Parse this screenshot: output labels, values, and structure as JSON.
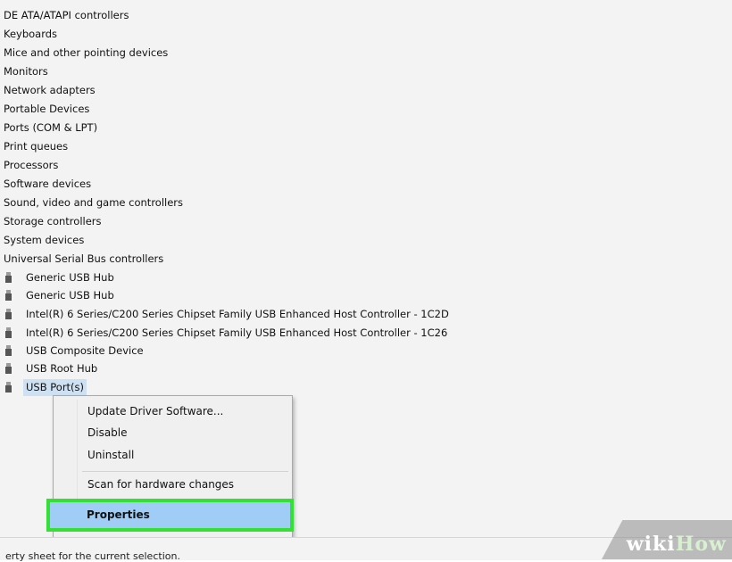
{
  "categories": [
    "DE ATA/ATAPI controllers",
    "Keyboards",
    "Mice and other pointing devices",
    "Monitors",
    "Network adapters",
    "Portable Devices",
    "Ports (COM & LPT)",
    "Print queues",
    "Processors",
    "Software devices",
    "Sound, video and game controllers",
    "Storage controllers",
    "System devices",
    "Universal Serial Bus controllers"
  ],
  "usb_children": [
    "Generic USB Hub",
    "Generic USB Hub",
    "Intel(R) 6 Series/C200 Series Chipset Family USB Enhanced Host Controller - 1C2D",
    "Intel(R) 6 Series/C200 Series Chipset Family USB Enhanced Host Controller - 1C26",
    "USB Composite Device",
    "USB Root Hub",
    "USB Port(s)"
  ],
  "selected_device": "USB Port(s)",
  "context_menu": {
    "update": "Update Driver Software...",
    "disable": "Disable",
    "uninstall": "Uninstall",
    "scan": "Scan for hardware changes",
    "properties": "Properties"
  },
  "status_bar": "erty sheet for the current selection.",
  "watermark": {
    "wiki": "wiki",
    "how": "How"
  },
  "colors": {
    "highlight_border": "#33e033",
    "selected_item": "#9fcdf5"
  }
}
